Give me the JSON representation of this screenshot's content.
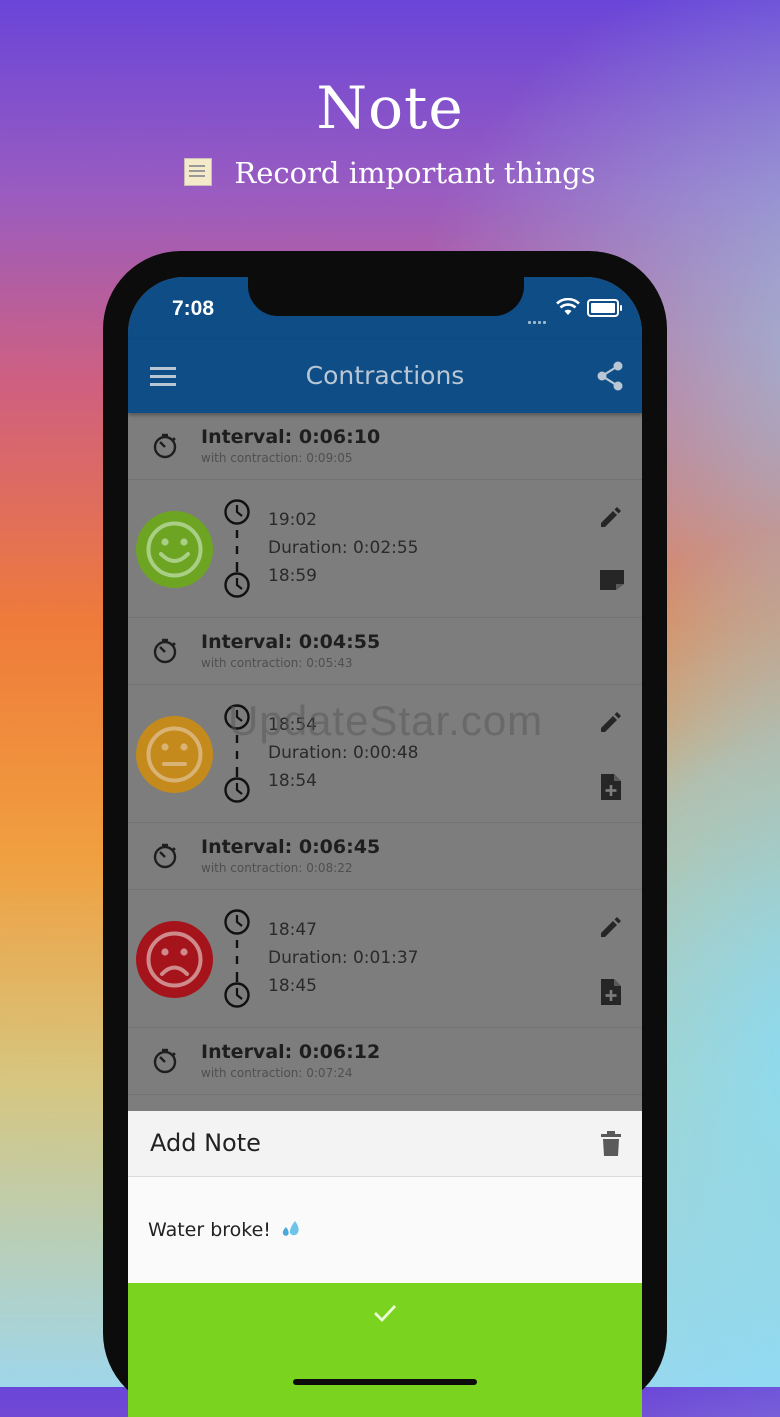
{
  "promo": {
    "title": "Note",
    "subtitle": "Record important things"
  },
  "status_bar": {
    "time": "7:08"
  },
  "app_bar": {
    "title": "Contractions"
  },
  "watermark": "UpdateStar.com",
  "intervals": [
    {
      "main": "Interval: 0:06:10",
      "sub": "with contraction: 0:09:05"
    },
    {
      "main": "Interval: 0:04:55",
      "sub": "with contraction: 0:05:43"
    },
    {
      "main": "Interval: 0:06:45",
      "sub": "with contraction: 0:08:22"
    },
    {
      "main": "Interval: 0:06:12",
      "sub": "with contraction: 0:07:24"
    }
  ],
  "contractions": [
    {
      "end": "19:02",
      "duration": "Duration: 0:02:55",
      "start": "18:59",
      "mood": "happy",
      "color": "#6da522",
      "note_icon": "note-icon"
    },
    {
      "end": "18:54",
      "duration": "Duration: 0:00:48",
      "start": "18:54",
      "mood": "neutral",
      "color": "#c48a1c",
      "note_icon": "note-add-icon"
    },
    {
      "end": "18:47",
      "duration": "Duration: 0:01:37",
      "start": "18:45",
      "mood": "sad",
      "color": "#a5141b",
      "note_icon": "note-add-icon"
    }
  ],
  "note_sheet": {
    "title": "Add Note",
    "text": "Water broke!",
    "confirm_color": "#7ad31f"
  },
  "colors": {
    "app_bar": "#0f4d86",
    "overlay": "#7d7d7d"
  }
}
